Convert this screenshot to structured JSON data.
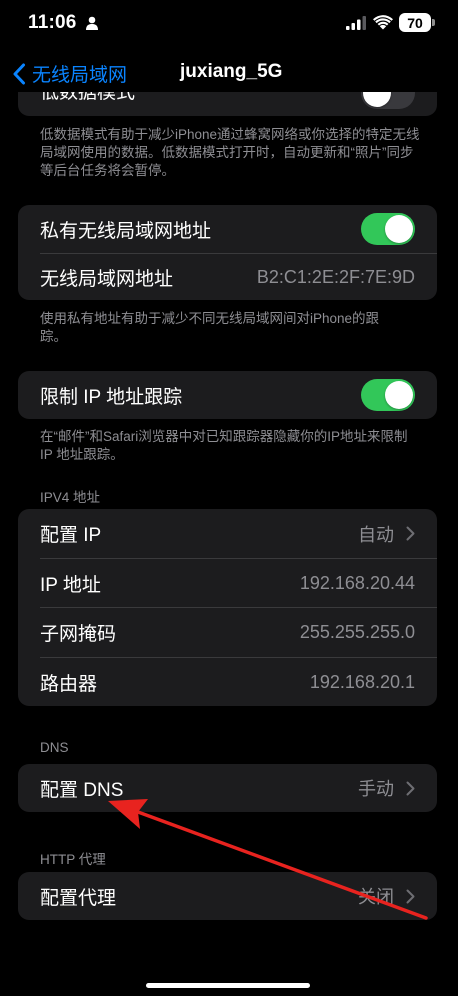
{
  "status": {
    "time": "11:06",
    "battery": "70"
  },
  "nav": {
    "back_label": "无线局域网",
    "title": "juxiang_5G"
  },
  "low_data": {
    "label": "低数据模式",
    "footnote": "低数据模式有助于减少iPhone通过蜂窝网络或你选择的特定无线局域网使用的数据。低数据模式打开时，自动更新和“照片”同步等后台任务将会暂停。"
  },
  "private_address": {
    "toggle_label": "私有无线局域网地址",
    "address_label": "无线局域网地址",
    "address_value": "B2:C1:2E:2F:7E:9D",
    "footnote": "使用私有地址有助于减少不同无线局域网间对iPhone的跟踪。"
  },
  "limit_tracking": {
    "label": "限制 IP 地址跟踪",
    "footnote": "在“邮件”和Safari浏览器中对已知跟踪器隐藏你的IP地址来限制 IP 地址跟踪。"
  },
  "ipv4": {
    "header": "IPV4 地址",
    "rows": [
      {
        "label": "配置 IP",
        "value": "自动"
      },
      {
        "label": "IP 地址",
        "value": "192.168.20.44"
      },
      {
        "label": "子网掩码",
        "value": "255.255.255.0"
      },
      {
        "label": "路由器",
        "value": "192.168.20.1"
      }
    ]
  },
  "dns": {
    "header": "DNS",
    "label": "配置 DNS",
    "value": "手动"
  },
  "http_proxy": {
    "header": "HTTP 代理",
    "label": "配置代理",
    "value": "关闭"
  },
  "colors": {
    "accent": "#0a84ff",
    "toggle_on": "#32c759",
    "annotation": "#e8231f"
  }
}
